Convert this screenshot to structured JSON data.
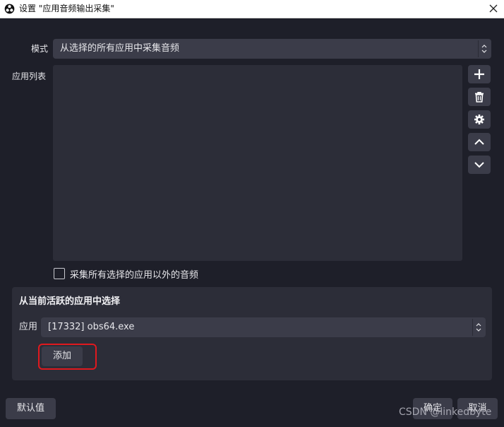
{
  "window": {
    "title": "设置 \"应用音频输出采集\""
  },
  "mode": {
    "label": "模式",
    "value": "从选择的所有应用中采集音频"
  },
  "app_list": {
    "label": "应用列表",
    "items": []
  },
  "side_buttons": [
    "plus-icon",
    "trash-icon",
    "gear-icon",
    "chevron-up-icon",
    "chevron-down-icon"
  ],
  "exclude_checkbox": {
    "label": "采集所有选择的应用以外的音频",
    "checked": false
  },
  "active_group": {
    "title": "从当前活跃的应用中选择",
    "app_label": "应用",
    "app_value": "[17332] obs64.exe",
    "add_label": "添加"
  },
  "footer": {
    "defaults_label": "默认值",
    "ok_label": "确定",
    "cancel_label": "取消"
  },
  "watermark": "CSDN @linkedbyte",
  "colors": {
    "highlight": "#e0191e",
    "background": "#1e1f29",
    "panel": "#2c2d38"
  }
}
